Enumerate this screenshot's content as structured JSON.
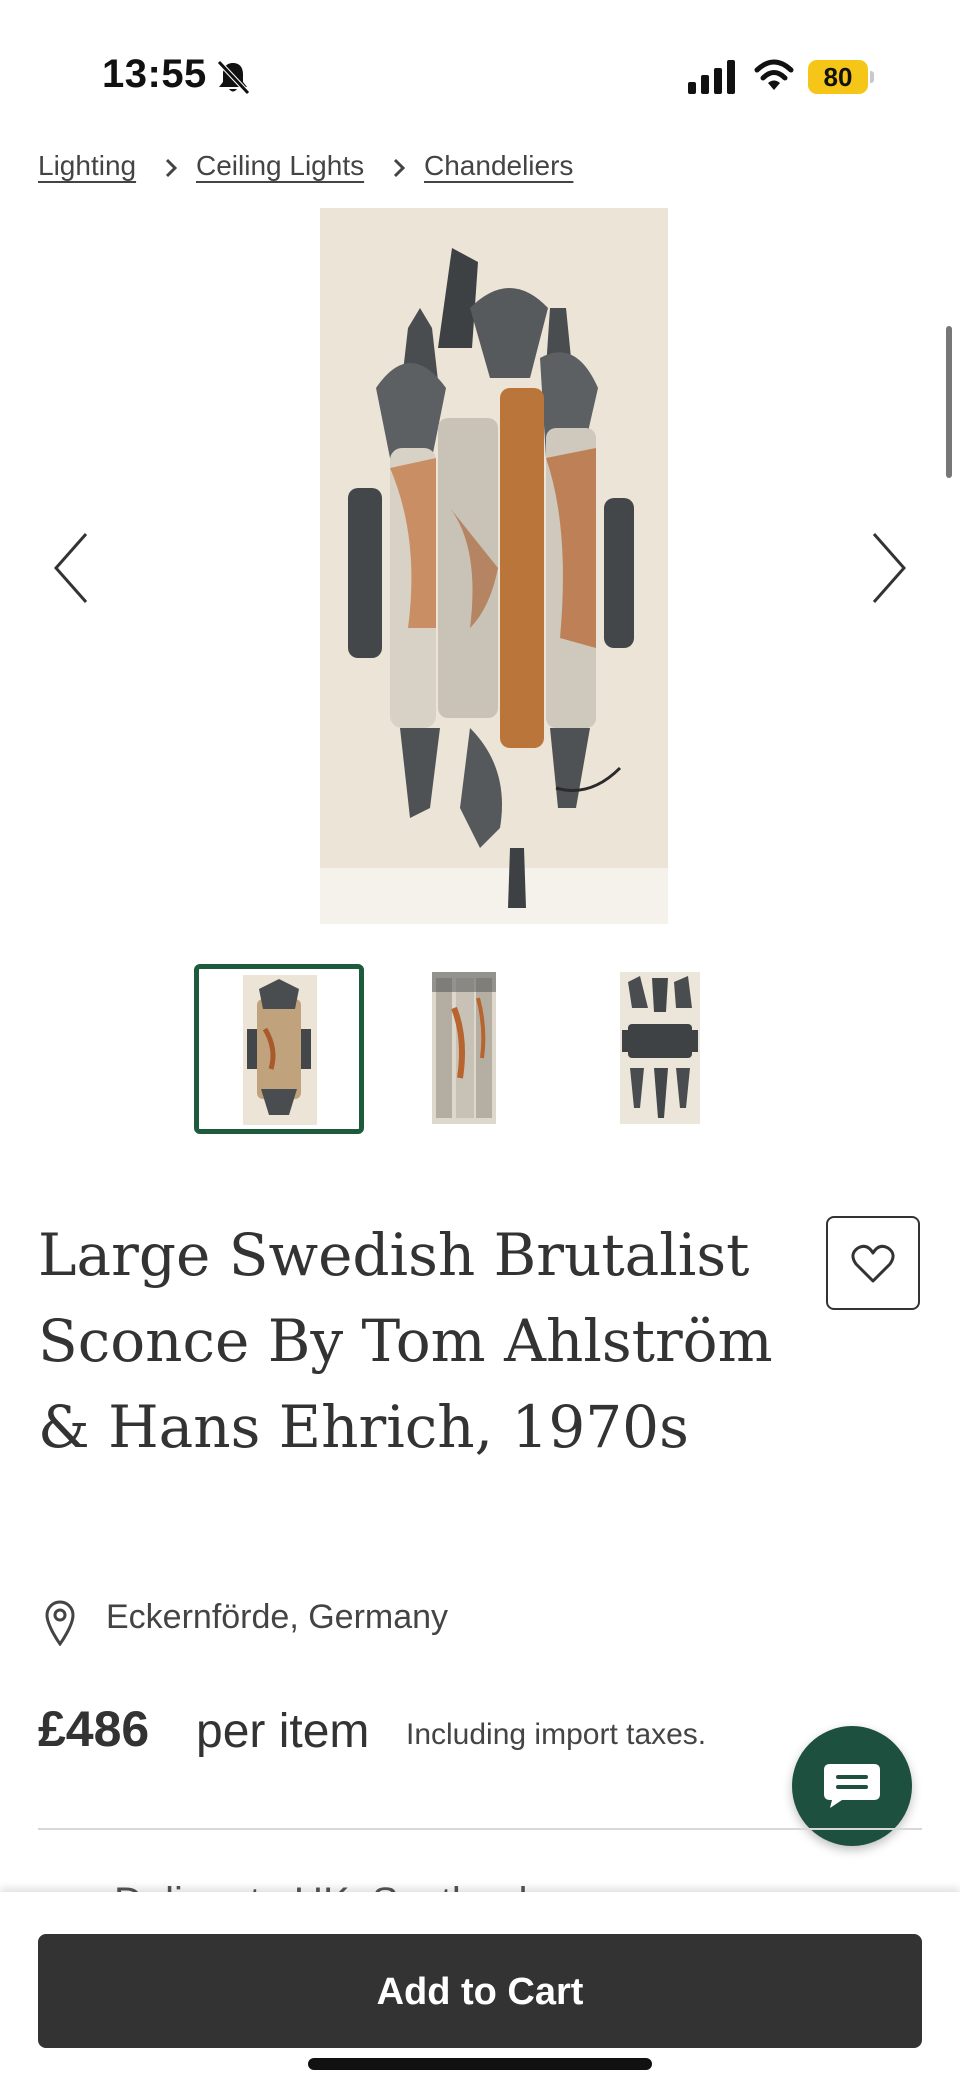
{
  "status_bar": {
    "time": "13:55",
    "battery": "80"
  },
  "breadcrumb": [
    {
      "label": "Lighting"
    },
    {
      "label": "Ceiling Lights"
    },
    {
      "label": "Chandeliers"
    }
  ],
  "gallery": {
    "thumbnail_count": 3,
    "selected_index": 0
  },
  "product": {
    "title": "Large Swedish Brutalist Sconce By Tom Ahlström & Hans Ehrich, 1970s",
    "location": "Eckernförde, Germany",
    "price": "£486",
    "price_unit": "per item",
    "tax_note": "Including import taxes."
  },
  "delivery_peek": "Deliver to UK, Scotland",
  "cart": {
    "label": "Add to Cart"
  },
  "colors": {
    "accent": "#1e5a3c",
    "chat": "#1e5040",
    "button": "#333333",
    "battery": "#f5c518"
  }
}
